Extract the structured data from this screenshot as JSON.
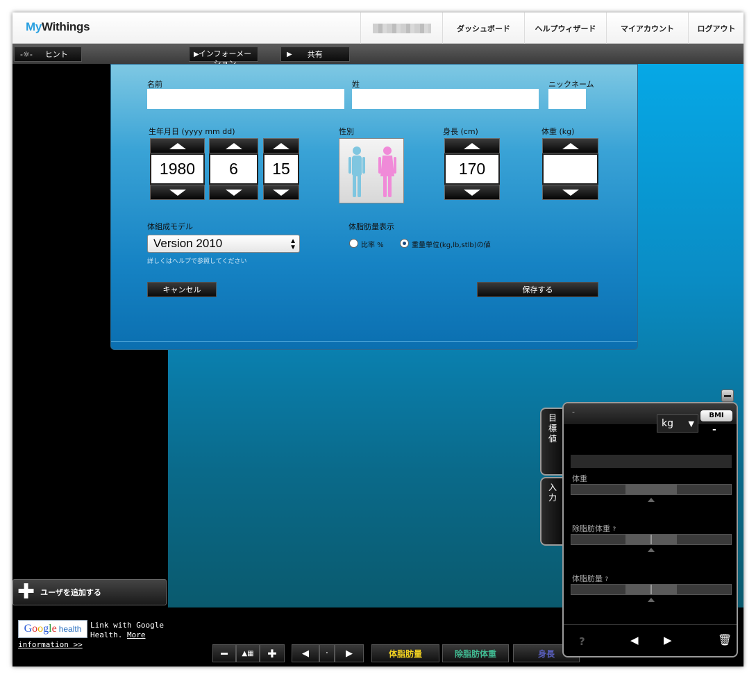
{
  "header": {
    "logo_my": "My",
    "logo_rest": "Withings",
    "nav": [
      "ダッシュボード",
      "ヘルプウィザード",
      "マイアカウント",
      "ログアウト"
    ]
  },
  "toolbar": {
    "hint": "ヒント",
    "information": "インフォーメーション",
    "share": "共有"
  },
  "form": {
    "first_name_label": "名前",
    "last_name_label": "姓",
    "nickname_label": "ニックネーム",
    "first_name_value": "",
    "last_name_value": "",
    "nickname_value": "",
    "birthdate_label": "生年月日 (yyyy mm dd)",
    "birth_year": "1980",
    "birth_month": "6",
    "birth_day": "15",
    "gender_label": "性別",
    "height_label": "身長 (cm)",
    "height_value": "170",
    "weight_label": "体重 (kg)",
    "weight_value": "",
    "model_label": "体組成モデル",
    "model_value": "Version 2010",
    "model_help": "詳しくはヘルプで参照してください",
    "fat_display_label": "体脂肪量表示",
    "radio_ratio": "比率 %",
    "radio_weight": "重量単位(kg,lb,stlb)の値",
    "selected_radio": "weight",
    "cancel": "キャンセル",
    "save": "保存する"
  },
  "left": {
    "add_user": "ユーザを追加する",
    "google_logo": "Google",
    "google_health": "health",
    "google_link": "Link with Google Health.",
    "google_more": "More",
    "google_info": "information >>"
  },
  "bottom": {
    "fat_mass": "体脂肪量",
    "lean_mass": "除脂肪体重",
    "height": "身長"
  },
  "widget": {
    "dash": "-",
    "unit": "kg",
    "bmi_label": "BMI",
    "bmi_value": "-",
    "tab_goal": "目標値",
    "tab_input": "入力",
    "weight_label": "体重",
    "lean_label": "除脂肪体重",
    "fat_label": "体脂肪量",
    "help_mark": "?"
  },
  "colors": {
    "accent_blue": "#06a8e6",
    "fat_mass_text": "#f0d020",
    "lean_mass_text": "#40b890",
    "height_text": "#5a60c0"
  }
}
